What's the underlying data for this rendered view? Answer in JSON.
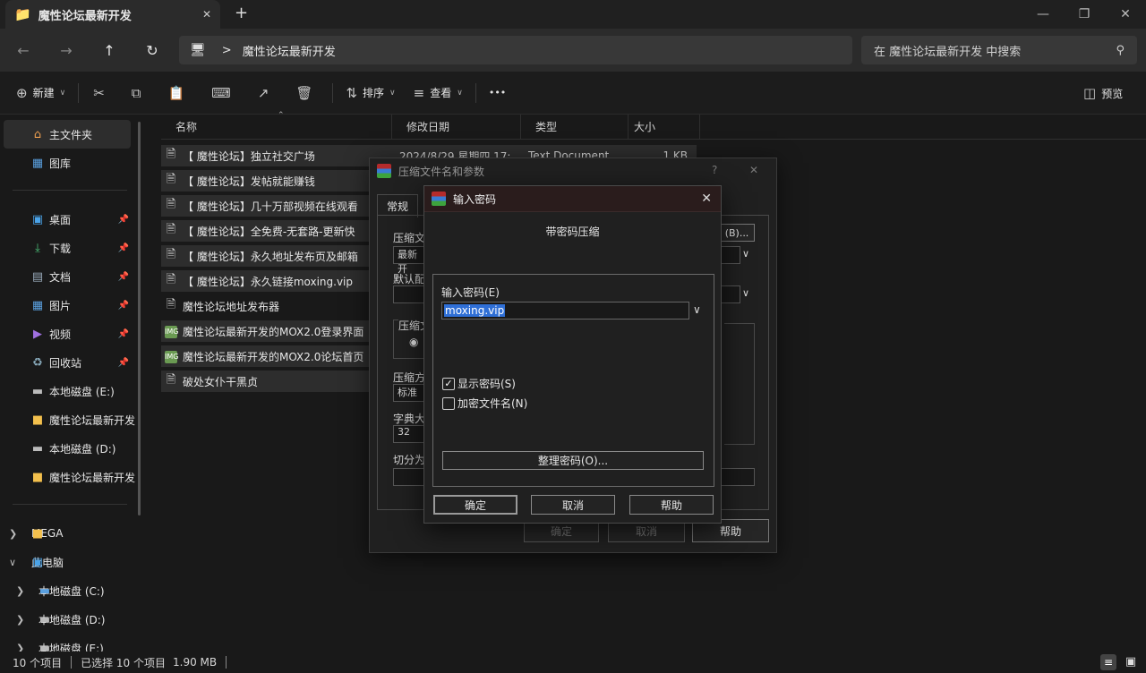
{
  "window": {
    "tab_title": "魔性论坛最新开发",
    "new_tab": "+",
    "minimize": "—",
    "maximize": "❐",
    "close": "✕"
  },
  "nav": {
    "back": "←",
    "forward": "→",
    "up": "↑",
    "refresh": "↻",
    "breadcrumb_sep": ">",
    "breadcrumb": "魔性论坛最新开发",
    "search_placeholder": "在 魔性论坛最新开发 中搜索"
  },
  "commands": {
    "new": "新建",
    "sort": "排序",
    "view": "查看",
    "more": "•••",
    "preview": "预览"
  },
  "sidebar": {
    "top": [
      {
        "label": "主文件夹",
        "icon": "home-icon"
      },
      {
        "label": "图库",
        "icon": "gallery-icon"
      }
    ],
    "quick": [
      {
        "label": "桌面",
        "icon": "desktop-icon"
      },
      {
        "label": "下载",
        "icon": "download-icon"
      },
      {
        "label": "文档",
        "icon": "document-icon"
      },
      {
        "label": "图片",
        "icon": "pictures-icon"
      },
      {
        "label": "视频",
        "icon": "video-icon"
      },
      {
        "label": "回收站",
        "icon": "recycle-bin-icon"
      },
      {
        "label": "本地磁盘 (E:)",
        "icon": "drive-icon"
      },
      {
        "label": "魔性论坛最新开发",
        "icon": "folder-icon"
      },
      {
        "label": "本地磁盘 (D:)",
        "icon": "drive-icon"
      },
      {
        "label": "魔性论坛最新开发",
        "icon": "folder-icon"
      }
    ],
    "tree": [
      {
        "label": "MEGA",
        "chev": ">"
      },
      {
        "label": "此电脑",
        "chev": "v"
      }
    ],
    "drives": [
      {
        "label": "本地磁盘 (C:)"
      },
      {
        "label": "本地磁盘 (D:)"
      },
      {
        "label": "本地磁盘 (E:)"
      }
    ]
  },
  "columns": {
    "name": "名称",
    "date": "修改日期",
    "type": "类型",
    "size": "大小"
  },
  "files": [
    {
      "name": "【 魔性论坛】独立社交广场",
      "date": "2024/8/29 星期四 17:",
      "type": "Text Document",
      "size": "1 KB",
      "kind": "doc",
      "sel": true
    },
    {
      "name": "【 魔性论坛】发帖就能赚钱",
      "date": "",
      "type": "",
      "size": "",
      "kind": "doc",
      "sel": true
    },
    {
      "name": "【 魔性论坛】几十万部视频在线观看",
      "date": "",
      "type": "",
      "size": "",
      "kind": "doc",
      "sel": true
    },
    {
      "name": "【 魔性论坛】全免费-无套路-更新快",
      "date": "",
      "type": "",
      "size": "",
      "kind": "doc",
      "sel": true
    },
    {
      "name": "【 魔性论坛】永久地址发布页及邮箱",
      "date": "",
      "type": "",
      "size": "",
      "kind": "doc",
      "sel": true
    },
    {
      "name": "【 魔性论坛】永久链接moxing.vip",
      "date": "",
      "type": "",
      "size": "",
      "kind": "doc",
      "sel": true
    },
    {
      "name": "魔性论坛地址发布器",
      "date": "",
      "type": "",
      "size": "",
      "kind": "doc",
      "sel": false
    },
    {
      "name": "魔性论坛最新开发的MOX2.0登录界面",
      "date": "",
      "type": "",
      "size": "",
      "kind": "rar",
      "sel": true
    },
    {
      "name": "魔性论坛最新开发的MOX2.0论坛首页",
      "date": "",
      "type": "",
      "size": "",
      "kind": "rar",
      "sel": true
    },
    {
      "name": "破处女仆干黑贞",
      "date": "",
      "type": "",
      "size": "",
      "kind": "doc",
      "sel": true
    }
  ],
  "status": {
    "count": "10 个项目",
    "selected": "已选择 10 个项目",
    "size": "1.90 MB"
  },
  "archive_dialog": {
    "title": "压缩文件名和参数",
    "help": "?",
    "close": "✕",
    "tab_general": "常规",
    "label_name": "压缩文",
    "value_name": "最新开",
    "browse": "(B)...",
    "label_profile": "默认配",
    "label_format": "压缩文",
    "label_method": "压缩方",
    "value_method": "标准",
    "label_dict": "字典大",
    "value_dict": "32",
    "label_split": "切分为",
    "ok": "确定",
    "cancel": "取消",
    "help_btn": "帮助"
  },
  "password_dialog": {
    "title": "输入密码",
    "close": "✕",
    "heading": "带密码压缩",
    "enter_label": "输入密码(E)",
    "password_value": "moxing.vip",
    "show_password": "显示密码(S)",
    "show_checked": true,
    "encrypt_names": "加密文件名(N)",
    "encrypt_checked": false,
    "organize": "整理密码(O)...",
    "ok": "确定",
    "cancel": "取消",
    "help": "帮助"
  }
}
